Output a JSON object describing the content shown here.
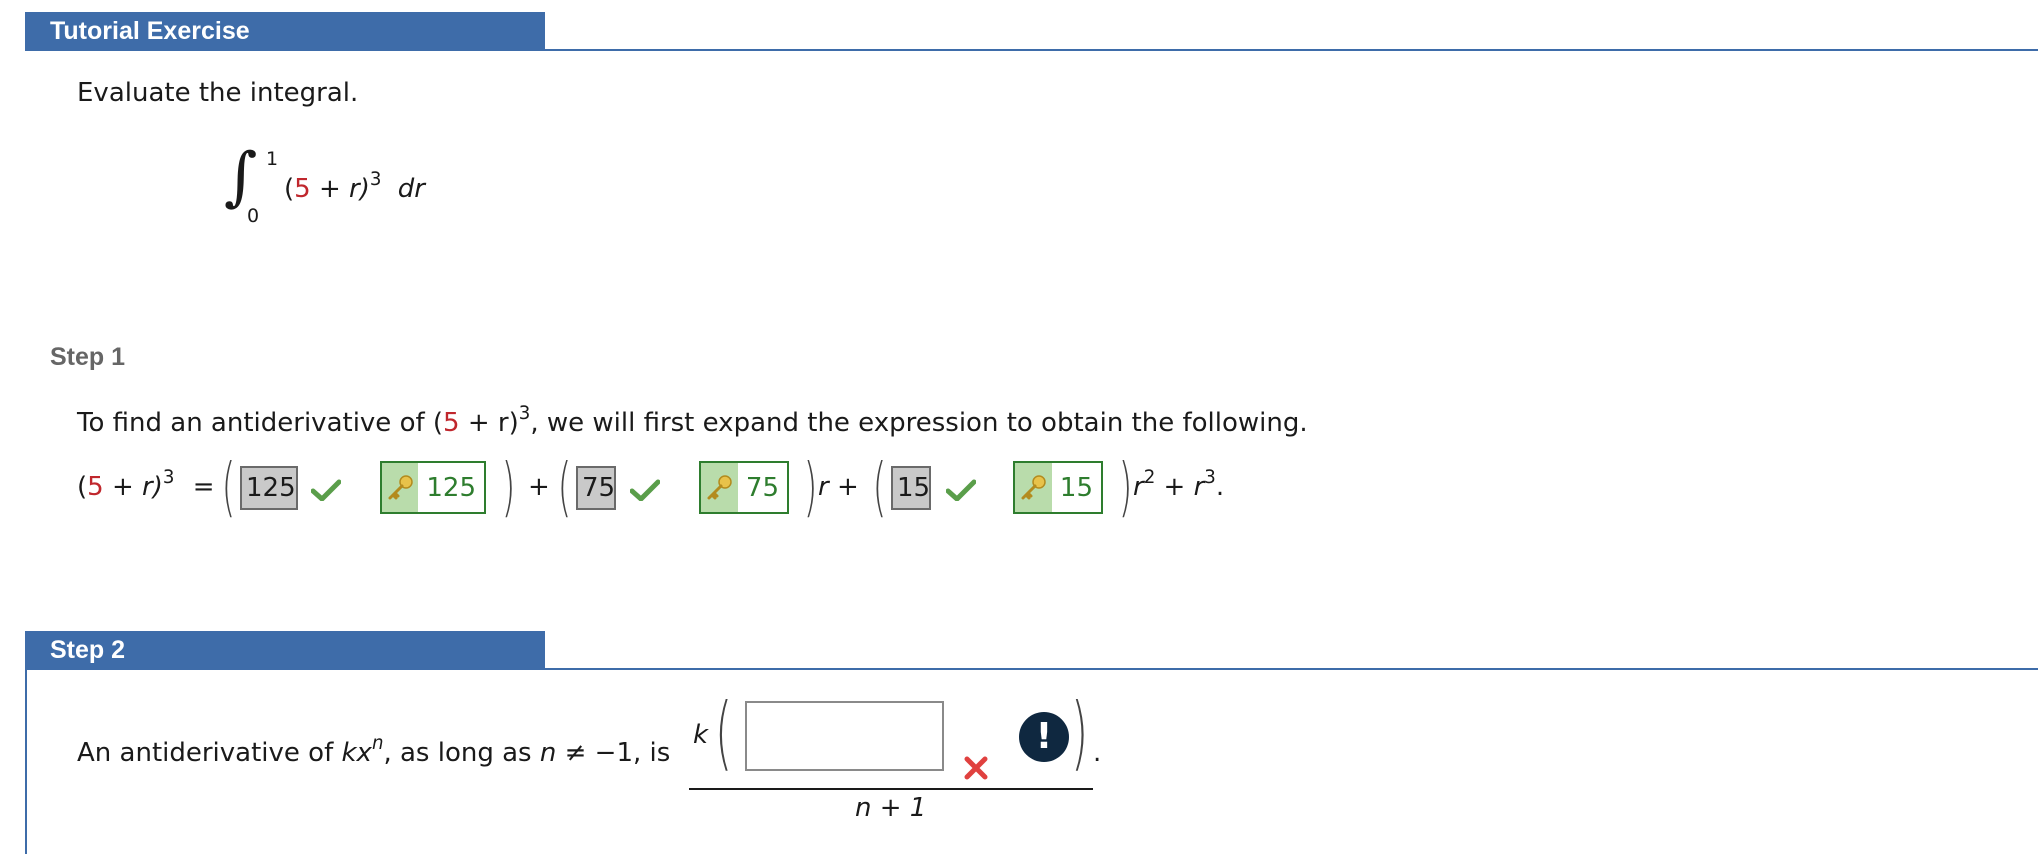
{
  "header": {
    "title": "Tutorial Exercise"
  },
  "problem": {
    "instruction": "Evaluate the integral.",
    "integral": {
      "upper": "1",
      "lower": "0",
      "open": "(",
      "five": "5",
      "plus_r": " + r)",
      "exp": "3",
      "dr": "dr"
    }
  },
  "step1": {
    "label": "Step 1",
    "sentence_a": "To find an antiderivative of (",
    "sentence_five": "5",
    "sentence_b": " + r)",
    "sentence_exp": "3",
    "sentence_c": ", we will first expand the expression to obtain the following.",
    "lhs_open": "(",
    "lhs_five": "5",
    "lhs_rest": " + r)",
    "lhs_exp": "3",
    "equals": "=",
    "answers": [
      {
        "value": "125",
        "key": "125",
        "status": "correct"
      },
      {
        "value": "75",
        "key": "75",
        "status": "correct"
      },
      {
        "value": "15",
        "key": "15",
        "status": "correct"
      }
    ],
    "plus": "+",
    "r_plus": "r +",
    "r2": "r",
    "r2_exp": "2",
    "tail": " + r",
    "tail_exp": "3",
    "period": "."
  },
  "step2": {
    "label": "Step 2",
    "sentence_a": "An antiderivative of ",
    "kx": "kx",
    "n_exp": "n",
    "sentence_b": ", as long as ",
    "n": "n",
    "neq": " ≠ −1, is",
    "k": "k",
    "input_value": "",
    "status": "incorrect",
    "alert_symbol": "!",
    "denominator": "n + 1",
    "period": "."
  },
  "colors": {
    "header": "#3e6ca9",
    "red_number": "#c0272d",
    "correct_green": "#2e7d2e",
    "key_bg": "#b9dcab",
    "wrong_red": "#e0413f",
    "alert_bg": "#0f2840"
  },
  "icons": [
    "check-icon",
    "key-icon",
    "wrong-x-icon",
    "alert-icon"
  ]
}
